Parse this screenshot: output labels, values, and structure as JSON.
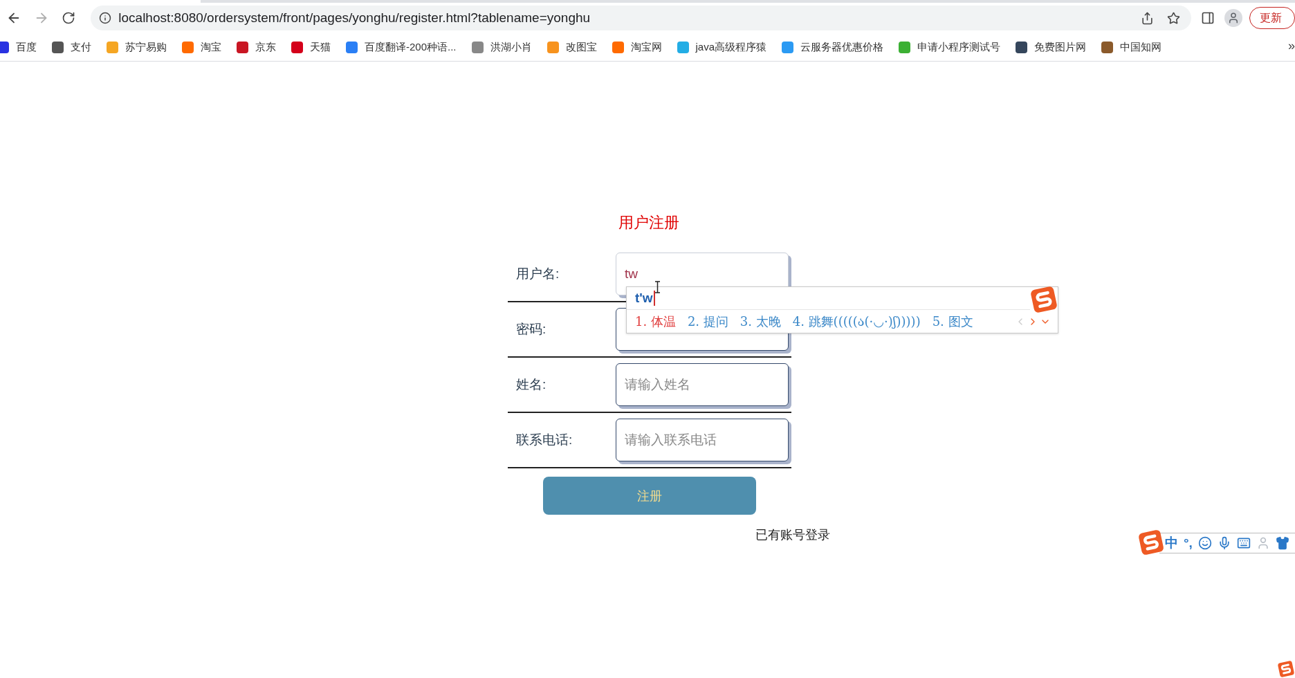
{
  "browser": {
    "url": "localhost:8080/ordersystem/front/pages/yonghu/register.html?tablename=yonghu",
    "update_button": "更新"
  },
  "bookmarks": [
    {
      "label": "百度",
      "color": "#2932e1"
    },
    {
      "label": "支付",
      "color": "#555555"
    },
    {
      "label": "苏宁易购",
      "color": "#f5a623"
    },
    {
      "label": "淘宝",
      "color": "#ff6a00"
    },
    {
      "label": "京东",
      "color": "#c91623"
    },
    {
      "label": "天猫",
      "color": "#d4001a"
    },
    {
      "label": "百度翻译-200种语...",
      "color": "#2a7ff5"
    },
    {
      "label": "洪湖小肖",
      "color": "#888888"
    },
    {
      "label": "改图宝",
      "color": "#f7931e"
    },
    {
      "label": "淘宝网",
      "color": "#ff6a00"
    },
    {
      "label": "java高级程序猿",
      "color": "#23ade5"
    },
    {
      "label": "云服务器优惠价格",
      "color": "#2b9af3"
    },
    {
      "label": "申请小程序测试号",
      "color": "#3cb034"
    },
    {
      "label": "免费图片网",
      "color": "#35465c"
    },
    {
      "label": "中国知网",
      "color": "#8b5a2b"
    }
  ],
  "bookmarks_overflow": "»",
  "form": {
    "title": "用户注册",
    "fields": [
      {
        "label": "用户名:",
        "value": "tw"
      },
      {
        "label": "密码:"
      },
      {
        "label": "姓名:",
        "placeholder": "请输入姓名"
      },
      {
        "label": "联系电话:",
        "placeholder": "请输入联系电话"
      }
    ],
    "submit": "注册",
    "login_link": "已有账号登录"
  },
  "ime_popup": {
    "composition": "t'w",
    "candidates": [
      {
        "text": "1. 体温",
        "selected": true
      },
      {
        "text": "2. 提问",
        "selected": false
      },
      {
        "text": "3. 太晚",
        "selected": false
      },
      {
        "text": "4. 跳舞(((((ა(·◡·)ʃ)))))",
        "selected": false
      },
      {
        "text": "5. 图文",
        "selected": false
      }
    ]
  },
  "ime_toolbar": {
    "mode": "中",
    "punctuation": "°,"
  }
}
